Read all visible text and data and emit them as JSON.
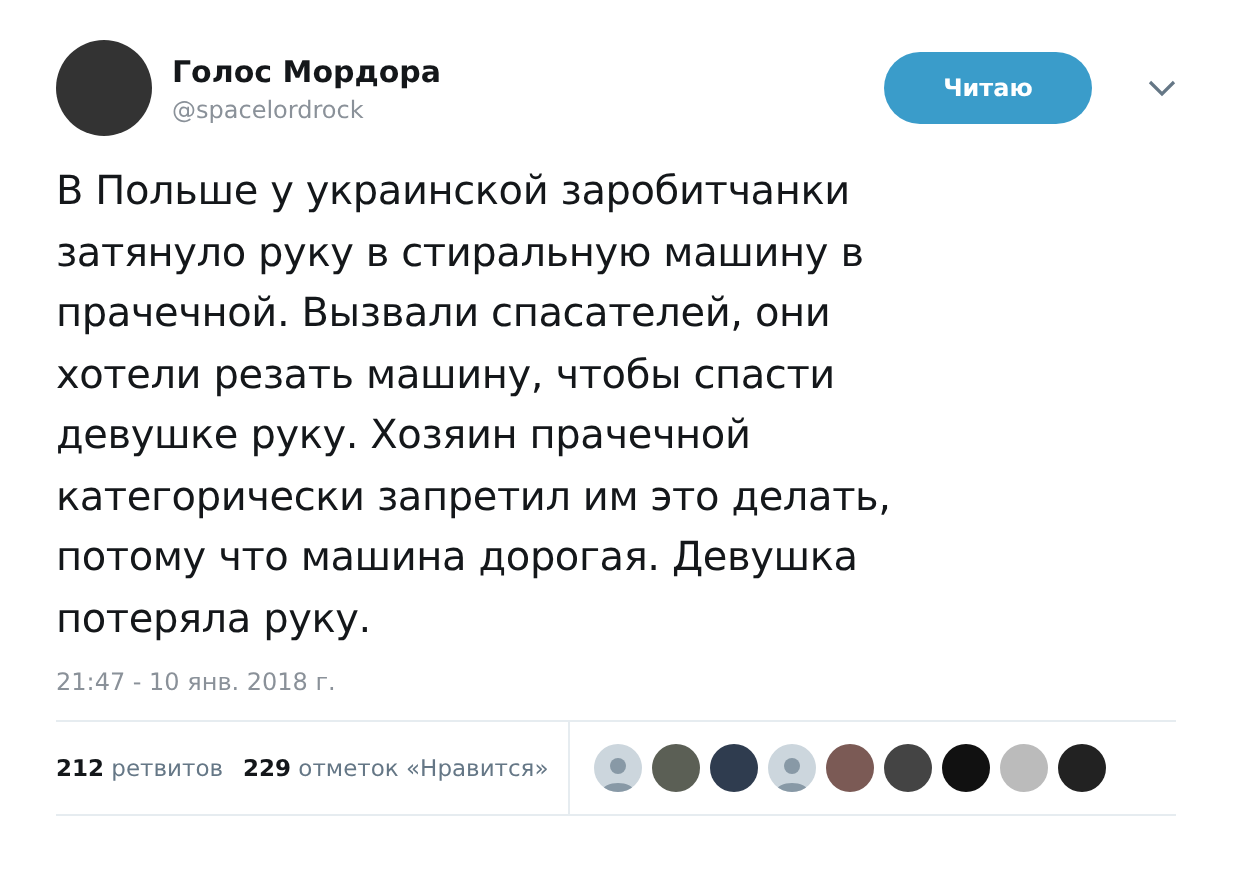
{
  "author": {
    "name": "Голос Мордора",
    "handle": "@spacelordrock"
  },
  "follow_button": {
    "label": "Читаю"
  },
  "tweet": {
    "lines": [
      "В Польше у украинской заробитчанки",
      "затянуло руку в стиральную машину в",
      "прачечной. Вызвали спасателей, они",
      "хотели резать машину, чтобы спасти",
      "девушке руку. Хозяин прачечной",
      "категорически запретил им это делать,",
      "потому что машина дорогая. Девушка",
      "потеряла руку."
    ]
  },
  "timestamp": "21:47 - 10 янв. 2018 г.",
  "stats": [
    {
      "text": "**212** ретвитов"
    },
    {
      "text": "**229** отметок «Нравится»"
    }
  ],
  "likers": [
    {
      "kind": "default"
    },
    {
      "kind": "photo"
    },
    {
      "kind": "photo"
    },
    {
      "kind": "default"
    },
    {
      "kind": "photo"
    },
    {
      "kind": "photo"
    },
    {
      "kind": "photo"
    },
    {
      "kind": "photo"
    },
    {
      "kind": "photo"
    }
  ]
}
